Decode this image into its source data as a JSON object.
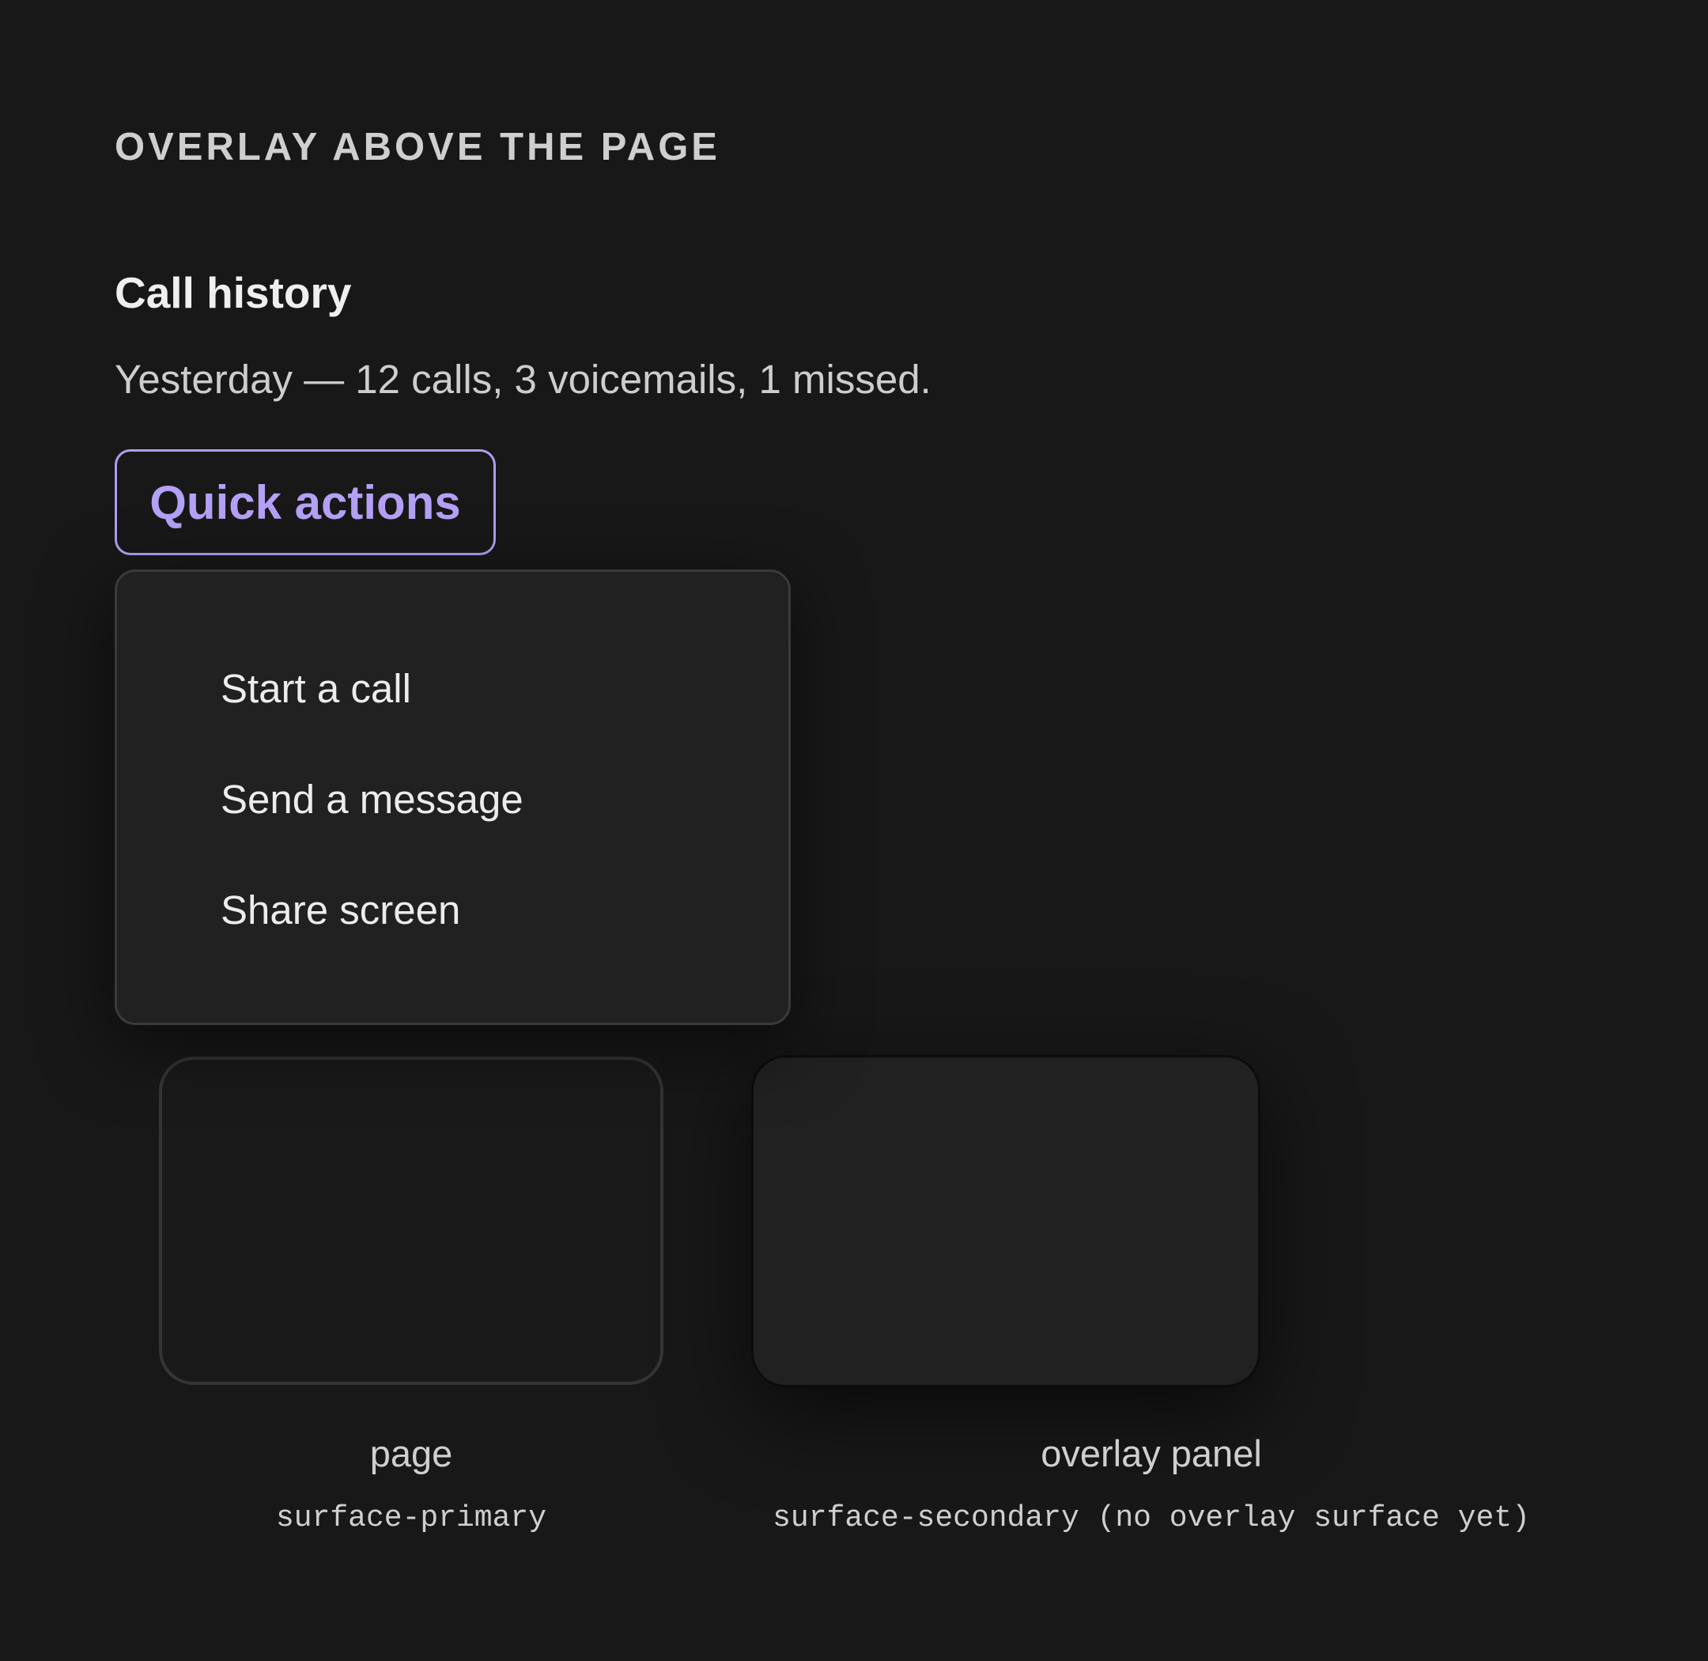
{
  "section": {
    "heading": "OVERLAY ABOVE THE PAGE"
  },
  "page": {
    "title": "Call history",
    "summary": "Yesterday — 12 calls, 3 voicemails, 1 missed."
  },
  "quick_actions": {
    "button_label": "Quick actions",
    "menu_items": [
      {
        "label": "Start a call"
      },
      {
        "label": "Send a message"
      },
      {
        "label": "Share screen"
      }
    ]
  },
  "swatches": [
    {
      "name": "page",
      "token": "surface-primary"
    },
    {
      "name": "overlay panel",
      "token": "surface-secondary (no overlay surface yet)"
    }
  ],
  "colors": {
    "background": "#181818",
    "surface_primary": "#1a1a1a",
    "surface_secondary": "#212121",
    "accent": "#b19cf0"
  }
}
